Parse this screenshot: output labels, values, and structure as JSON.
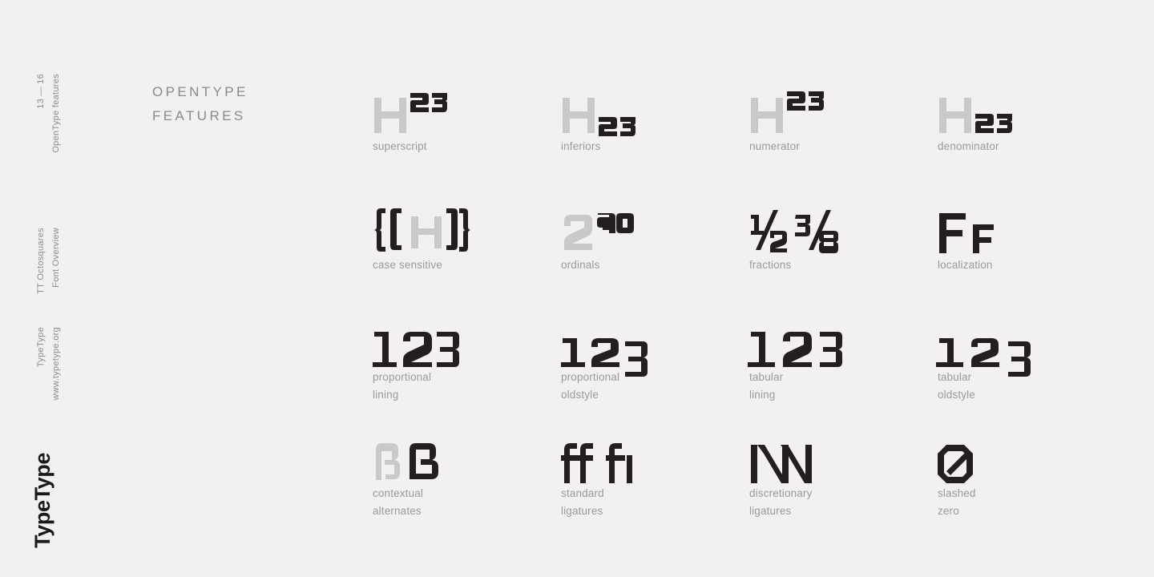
{
  "page": {
    "background": "#f2f1ef",
    "ink_color": "#231f20",
    "ghost_color": "#c9c9c7",
    "caption_color": "#9a9a9a"
  },
  "rail": {
    "page_range": "13 — 16",
    "section": "OpenType features",
    "doc_title": "TT Octosquares",
    "doc_subtitle": "Font Overview",
    "brand": "TypeType",
    "website": "www.typetype.org",
    "logo": "TypeType"
  },
  "heading": {
    "title": "OPENTYPE\nFEATURES"
  },
  "features": [
    {
      "id": "superscript",
      "caption": "superscript",
      "sample": "H23",
      "col": 0,
      "row": 0
    },
    {
      "id": "inferiors",
      "caption": "inferiors",
      "sample": "H23",
      "col": 1,
      "row": 0
    },
    {
      "id": "numerator",
      "caption": "numerator",
      "sample": "H23",
      "col": 2,
      "row": 0
    },
    {
      "id": "denominator",
      "caption": "denominator",
      "sample": "H23",
      "col": 3,
      "row": 0
    },
    {
      "id": "case-sensitive",
      "caption": "case sensitive",
      "sample": "{([H])}",
      "col": 0,
      "row": 1
    },
    {
      "id": "ordinals",
      "caption": "ordinals",
      "sample": "2ao",
      "col": 1,
      "row": 1
    },
    {
      "id": "fractions",
      "caption": "fractions",
      "sample": "½ ⅜",
      "col": 2,
      "row": 1
    },
    {
      "id": "localization",
      "caption": "localization",
      "sample": "FF",
      "col": 3,
      "row": 1
    },
    {
      "id": "proportional-lining",
      "caption": "proportional\nlining",
      "sample": "123",
      "col": 0,
      "row": 2
    },
    {
      "id": "proportional-oldstyle",
      "caption": "proportional\noldstyle",
      "sample": "123",
      "col": 1,
      "row": 2
    },
    {
      "id": "tabular-lining",
      "caption": "tabular\nlining",
      "sample": "123",
      "col": 2,
      "row": 2
    },
    {
      "id": "tabular-oldstyle",
      "caption": "tabular\noldstyle",
      "sample": "123",
      "col": 3,
      "row": 2
    },
    {
      "id": "contextual-alternates",
      "caption": "contextual\nalternates",
      "sample": "ßß",
      "col": 0,
      "row": 3
    },
    {
      "id": "standard-ligatures",
      "caption": "standard\nligatures",
      "sample": "ff fi",
      "col": 1,
      "row": 3
    },
    {
      "id": "discretionary-ligatures",
      "caption": "discretionary\nligatures",
      "sample": "NN",
      "col": 2,
      "row": 3
    },
    {
      "id": "slashed-zero",
      "caption": "slashed\nzero",
      "sample": "0",
      "col": 3,
      "row": 3
    }
  ]
}
